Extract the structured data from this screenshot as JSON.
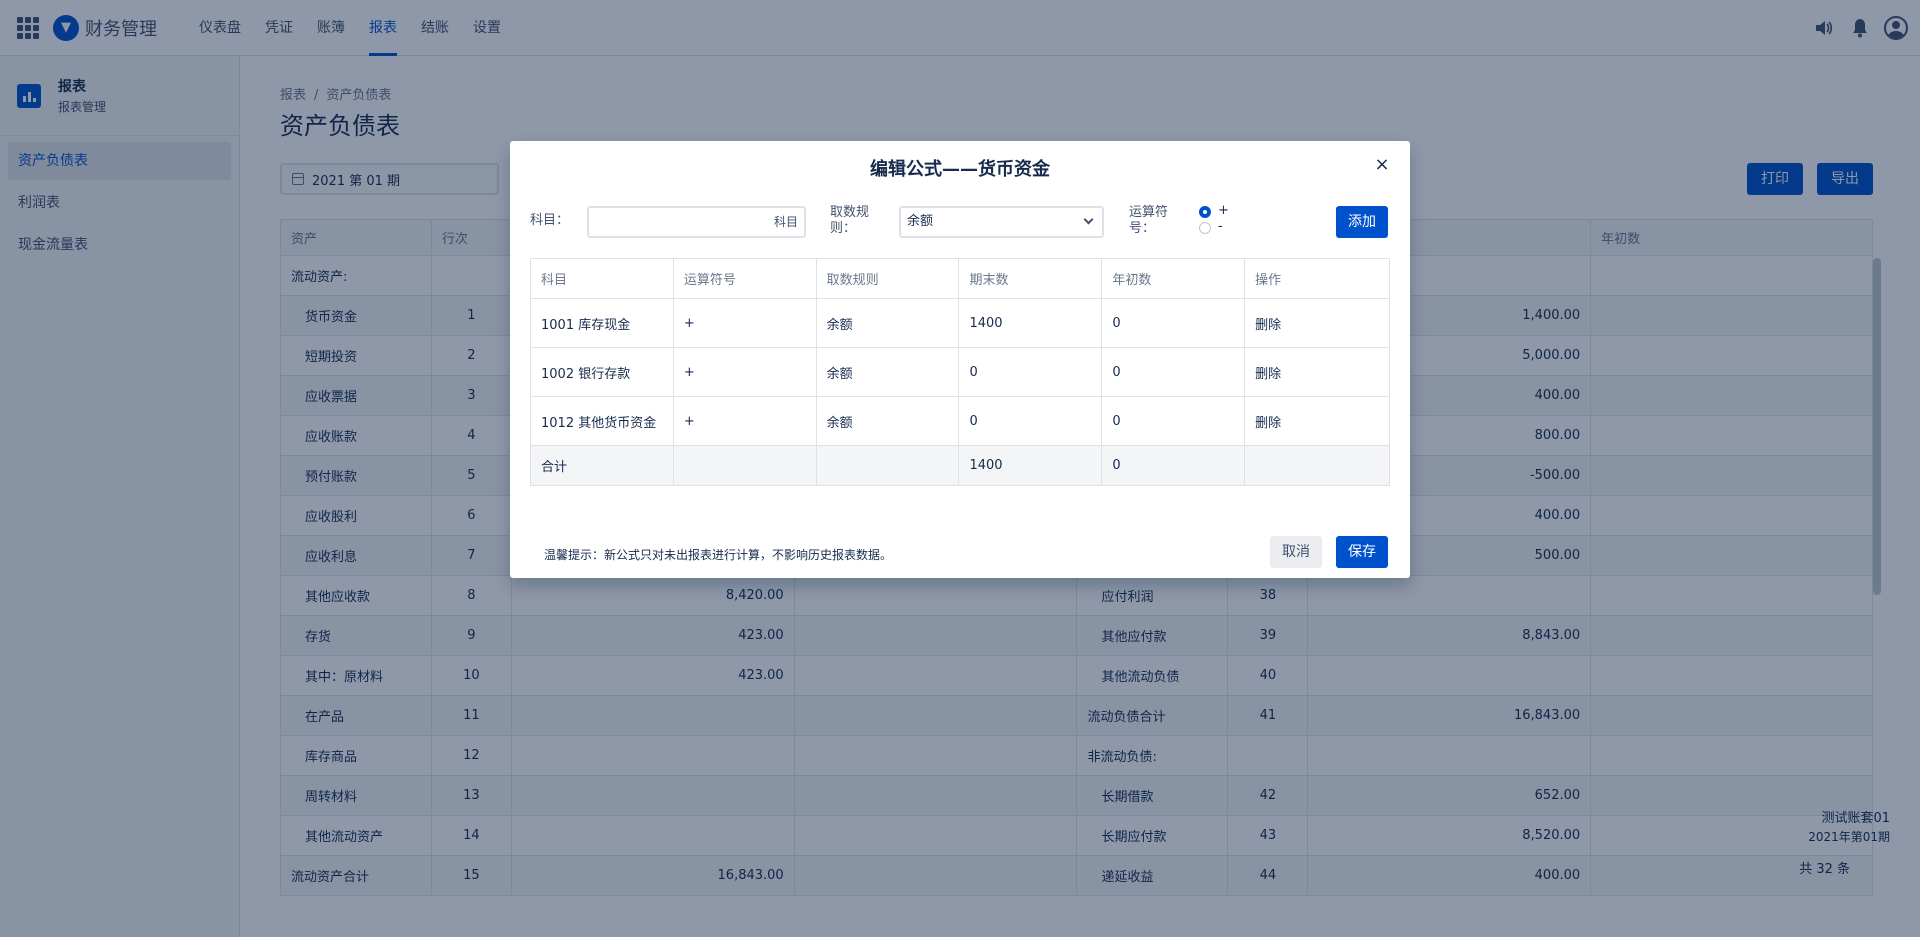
{
  "app": {
    "title": "财务管理",
    "logo_icon": "▼"
  },
  "nav": [
    {
      "label": "仪表盘",
      "active": false
    },
    {
      "label": "凭证",
      "active": false
    },
    {
      "label": "账簿",
      "active": false
    },
    {
      "label": "报表",
      "active": true
    },
    {
      "label": "结账",
      "active": false
    },
    {
      "label": "设置",
      "active": false
    }
  ],
  "sidebar": {
    "title": "报表",
    "subtitle": "报表管理",
    "items": [
      {
        "label": "资产负债表",
        "active": true
      },
      {
        "label": "利润表",
        "active": false
      },
      {
        "label": "现金流量表",
        "active": false
      }
    ]
  },
  "main": {
    "breadcrumb": [
      "报表",
      "资产负债表"
    ],
    "breadcrumb_sep": "/",
    "title": "资产负债表",
    "period": "2021 第 01 期",
    "print_label": "打印",
    "export_label": "导出"
  },
  "bg_table": {
    "headers": [
      "资产",
      "行次",
      "",
      "",
      "",
      "",
      "",
      "年初数"
    ],
    "rows": [
      {
        "a": "流动资产:",
        "n": "",
        "e": "",
        "f": "",
        "g": "",
        "h": "",
        "i": "",
        "j": ""
      },
      {
        "a": "货币资金",
        "n": "1",
        "e": "",
        "f": "",
        "g": "",
        "h": "",
        "i": "1,400.00",
        "j": ""
      },
      {
        "a": "短期投资",
        "n": "2",
        "e": "",
        "f": "",
        "g": "",
        "h": "",
        "i": "5,000.00",
        "j": ""
      },
      {
        "a": "应收票据",
        "n": "3",
        "e": "",
        "f": "",
        "g": "",
        "h": "",
        "i": "400.00",
        "j": ""
      },
      {
        "a": "应收账款",
        "n": "4",
        "e": "",
        "f": "",
        "g": "",
        "h": "",
        "i": "800.00",
        "j": ""
      },
      {
        "a": "预付账款",
        "n": "5",
        "e": "",
        "f": "",
        "g": "",
        "h": "",
        "i": "-500.00",
        "j": ""
      },
      {
        "a": "应收股利",
        "n": "6",
        "e": "",
        "f": "",
        "g": "",
        "h": "",
        "i": "400.00",
        "j": ""
      },
      {
        "a": "应收利息",
        "n": "7",
        "e": "",
        "f": "",
        "g": "",
        "h": "",
        "i": "500.00",
        "j": ""
      },
      {
        "a": "其他应收款",
        "n": "8",
        "e": "8,420.00",
        "f": "",
        "g": "应付利润",
        "h": "38",
        "i": "",
        "j": ""
      },
      {
        "a": "存货",
        "n": "9",
        "e": "423.00",
        "f": "",
        "g": "其他应付款",
        "h": "39",
        "i": "8,843.00",
        "j": ""
      },
      {
        "a": "其中：原材料",
        "n": "10",
        "e": "423.00",
        "f": "",
        "g": "其他流动负债",
        "h": "40",
        "i": "",
        "j": ""
      },
      {
        "a": "在产品",
        "n": "11",
        "e": "",
        "f": "",
        "g": "流动负债合计",
        "h": "41",
        "i": "16,843.00",
        "j": ""
      },
      {
        "a": "库存商品",
        "n": "12",
        "e": "",
        "f": "",
        "g": "非流动负债:",
        "h": "",
        "i": "",
        "j": ""
      },
      {
        "a": "周转材料",
        "n": "13",
        "e": "",
        "f": "",
        "g": "长期借款",
        "h": "42",
        "i": "652.00",
        "j": ""
      },
      {
        "a": "其他流动资产",
        "n": "14",
        "e": "",
        "f": "",
        "g": "长期应付款",
        "h": "43",
        "i": "8,520.00",
        "j": ""
      },
      {
        "a": "流动资产合计",
        "n": "15",
        "e": "16,843.00",
        "f": "",
        "g": "递延收益",
        "h": "44",
        "i": "400.00",
        "j": ""
      }
    ]
  },
  "account": {
    "name": "测试账套01",
    "period": "2021年第01期"
  },
  "total_count": "共 32 条",
  "modal": {
    "title": "编辑公式——货币资金",
    "close_icon": "×",
    "subject_label": "科目：",
    "subject_placeholder": "科目",
    "rule_label_1": "取数规",
    "rule_label_2": "则：",
    "rule_value": "余额",
    "op_label_1": "运算符",
    "op_label_2": "号：",
    "op_options": [
      "+",
      "-"
    ],
    "op_selected": "+",
    "add_label": "添加",
    "columns": [
      "科目",
      "运算符号",
      "取数规则",
      "期末数",
      "年初数",
      "操作"
    ],
    "rows": [
      {
        "subject": "1001 库存现金",
        "op": "+",
        "rule": "余额",
        "end": "1400",
        "begin": "0",
        "action": "删除"
      },
      {
        "subject": "1002 银行存款",
        "op": "+",
        "rule": "余额",
        "end": "0",
        "begin": "0",
        "action": "删除"
      },
      {
        "subject": "1012 其他货币资金",
        "op": "+",
        "rule": "余额",
        "end": "0",
        "begin": "0",
        "action": "删除"
      }
    ],
    "total": {
      "label": "合计",
      "end": "1400",
      "begin": "0"
    },
    "hint": "温馨提示：新公式只对未出报表进行计算，不影响历史报表数据。",
    "cancel_label": "取消",
    "save_label": "保存"
  }
}
